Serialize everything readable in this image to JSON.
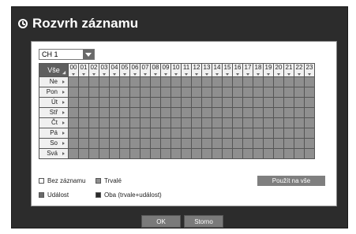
{
  "dialog": {
    "title": "Rozvrh záznamu",
    "channel_value": "CH 1"
  },
  "grid": {
    "all_label": "Vše",
    "hours": [
      "00",
      "01",
      "02",
      "03",
      "04",
      "05",
      "06",
      "07",
      "08",
      "09",
      "10",
      "11",
      "12",
      "13",
      "14",
      "15",
      "16",
      "17",
      "18",
      "19",
      "20",
      "21",
      "22",
      "23"
    ],
    "days": [
      "Ne",
      "Pon",
      "Út",
      "Stř",
      "Čt",
      "Pá",
      "So",
      "Svá"
    ]
  },
  "legend": {
    "none": "Bez záznamu",
    "continuous": "Trvalé",
    "event": "Událost",
    "both": "Oba (trvale+událost)"
  },
  "buttons": {
    "apply_all": "Použít na vše",
    "ok": "OK",
    "cancel": "Storno"
  },
  "colors": {
    "none": "#ffffff",
    "continuous": "#8f8f8f",
    "event": "#6a6a6a",
    "both": "#2a2a2a"
  }
}
